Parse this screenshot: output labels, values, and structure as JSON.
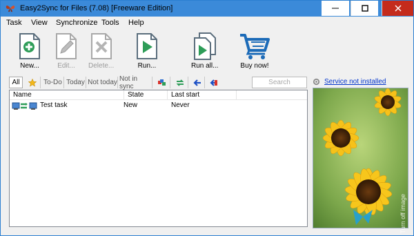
{
  "window": {
    "title": "Easy2Sync for Files (7.08) [Freeware Edition]",
    "controls": {
      "minimize_icon": "minimize-icon",
      "maximize_icon": "maximize-icon",
      "close_icon": "close-icon"
    }
  },
  "menu": [
    "Task",
    "View",
    "Synchronize",
    "Tools",
    "Help"
  ],
  "toolbar": {
    "new_label": "New...",
    "edit_label": "Edit...",
    "delete_label": "Delete...",
    "run_label": "Run...",
    "run_all_label": "Run all...",
    "buy_label": "Buy now!"
  },
  "filters": {
    "all": "All",
    "todo": "To-Do",
    "today": "Today",
    "not_today": "Not today",
    "not_in_sync": "Not in sync"
  },
  "search": {
    "placeholder": "Search"
  },
  "service": {
    "link": "Service not installed"
  },
  "list": {
    "columns": {
      "name": "Name",
      "state": "State",
      "last_start": "Last start"
    },
    "rows": [
      {
        "name": "Test task",
        "state": "New",
        "last_start": "Never"
      }
    ]
  },
  "side_panel": {
    "turn_off": "Turn off image"
  },
  "colors": {
    "titlebar": "#3b8ad9",
    "close": "#c42b1c",
    "link": "#0033cc",
    "accent_green": "#2e9d58",
    "cart": "#1c6bb8"
  }
}
